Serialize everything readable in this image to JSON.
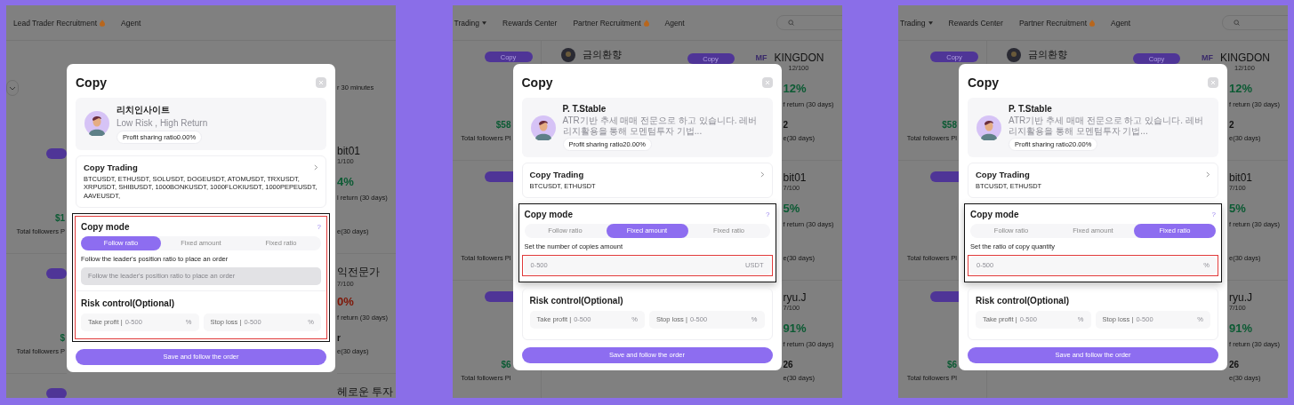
{
  "panels": [
    {
      "kind": "filtered",
      "nav": [
        {
          "label": "Lead Trader Recruitment",
          "dropdown": false,
          "hot": true
        },
        {
          "label": "Agent",
          "dropdown": false,
          "hot": false
        }
      ],
      "toolbar_text": "r 30 minutes",
      "left_cards": [
        {
          "kind": "copy-card",
          "value": "$1",
          "label": "Total followers P"
        },
        {
          "kind": "copy-card",
          "value": "$",
          "label": "Total followers P"
        },
        {
          "kind": "copy-card"
        }
      ],
      "right_cards": [
        {
          "name": "bit01",
          "count": "1/100",
          "pct": "4%",
          "color": "#0b5a33",
          "return_label": "l return (30 days)",
          "stat_label": "e(30 days)"
        },
        {
          "name": "익전문가",
          "count": "7/100",
          "pct": "0%",
          "color": "#7e1606",
          "return_label": "f return (30 days)",
          "stat": "r",
          "stat_label": "e(30 days)"
        },
        {
          "name": "헤로운 투자"
        }
      ],
      "dialog": {
        "title": "Copy",
        "trader": {
          "name": "리치인사이트",
          "description": "Low Risk , High Return",
          "badge": "Profit sharing ratio0.00%"
        },
        "copy_trading": {
          "title": "Copy Trading",
          "symbols": "BTCUSDT, ETHUSDT, SOLUSDT, DOGEUSDT, ATOMUSDT, TRXUSDT, XRPUSDT, SHIBUSDT, 1000BONKUSDT, 1000FLOKIUSDT, 1000PEPEUSDT, AAVEUSDT,"
        },
        "copy_mode": {
          "title": "Copy mode",
          "help": "?",
          "annotation": {
            "kind": "sections"
          },
          "tabs": [
            {
              "label": "Follow ratio",
              "selected": true
            },
            {
              "label": "Fixed amount",
              "selected": false
            },
            {
              "label": "Fixed ratio",
              "selected": false
            }
          ],
          "description": "Follow the leader's position ratio to place an order",
          "field": {
            "placeholder": "Follow the leader's position ratio to place an order",
            "disabled": true
          }
        },
        "risk": {
          "title": "Risk control(Optional)",
          "fields": [
            {
              "label": "Take profit |",
              "placeholder": "0-500",
              "suffix": "%"
            },
            {
              "label": "Stop loss |",
              "placeholder": "0-500",
              "suffix": "%"
            }
          ]
        },
        "save": "Save and follow the order"
      }
    },
    {
      "kind": "overview",
      "nav": [
        {
          "label": "Trading",
          "dropdown": true,
          "hot": false
        },
        {
          "label": "Rewards Center",
          "dropdown": false,
          "hot": false
        },
        {
          "label": "Partner Recruitment",
          "dropdown": false,
          "hot": true
        },
        {
          "label": "Agent",
          "dropdown": false,
          "hot": false
        }
      ],
      "search": true,
      "left_cards": [
        {
          "kind": "copy-card",
          "button": "Copy",
          "value": "$58",
          "label": "Total followers Pl"
        },
        {
          "kind": "copy-card",
          "label": "Total followers Pl"
        },
        {
          "kind": "copy-card",
          "value": "$6",
          "label": "Total followers Pl"
        }
      ],
      "middle_card": {
        "name": "금의환향",
        "button": "Copy"
      },
      "right_cards": [
        {
          "logo": "MF",
          "name": "KINGDON",
          "count": "12/100",
          "pct": "12%",
          "color": "#0b5a33",
          "return_label": "f return (30 days)",
          "stat": "2",
          "stat_label": "e(30 days)"
        },
        {
          "name": "bit01",
          "count": "7/100",
          "pct": "5%",
          "color": "#0b5a33",
          "return_label": "f return (30 days)",
          "stat_label": "e(30 days)"
        },
        {
          "name": "ryu.J",
          "count": "7/100",
          "pct": "91%",
          "color": "#0b5a33",
          "return_label": "f return (30 days)",
          "stat": "26",
          "stat_label": "e(30 days)"
        }
      ],
      "dialog": {
        "title": "Copy",
        "trader": {
          "name": "P. T.Stable",
          "description": "ATR기반 추세 매매 전문으로 하고 있습니다. 레버리지활용을 통해 모멘텀투자 기법...",
          "badge": "Profit sharing ratio20.00%"
        },
        "copy_trading": {
          "title": "Copy Trading",
          "symbols": "BTCUSDT, ETHUSDT"
        },
        "copy_mode": {
          "title": "Copy mode",
          "help": "?",
          "annotation": {
            "kind": "field"
          },
          "tabs": [
            {
              "label": "Follow ratio",
              "selected": false
            },
            {
              "label": "Fixed amount",
              "selected": true
            },
            {
              "label": "Fixed ratio",
              "selected": false
            }
          ],
          "description": "Set the number of copies amount",
          "field": {
            "placeholder": "0-500",
            "suffix": "USDT",
            "disabled": false
          }
        },
        "risk": {
          "title": "Risk control(Optional)",
          "fields": [
            {
              "label": "Take profit |",
              "placeholder": "0-500",
              "suffix": "%"
            },
            {
              "label": "Stop loss |",
              "placeholder": "0-500",
              "suffix": "%"
            }
          ]
        },
        "save": "Save and follow the order"
      }
    },
    {
      "kind": "overview",
      "nav": [
        {
          "label": "Trading",
          "dropdown": true,
          "hot": false
        },
        {
          "label": "Rewards Center",
          "dropdown": false,
          "hot": false
        },
        {
          "label": "Partner Recruitment",
          "dropdown": false,
          "hot": true
        },
        {
          "label": "Agent",
          "dropdown": false,
          "hot": false
        }
      ],
      "search": true,
      "left_cards": [
        {
          "kind": "copy-card",
          "button": "Copy",
          "value": "$58",
          "label": "Total followers Pl"
        },
        {
          "kind": "copy-card",
          "label": "Total followers Pl"
        },
        {
          "kind": "copy-card",
          "value": "$6",
          "label": "Total followers Pl"
        }
      ],
      "middle_card": {
        "name": "금의환향",
        "button": "Copy"
      },
      "right_cards": [
        {
          "logo": "MF",
          "name": "KINGDON",
          "count": "12/100",
          "pct": "12%",
          "color": "#0b5a33",
          "return_label": "f return (30 days)",
          "stat": "2",
          "stat_label": "e(30 days)"
        },
        {
          "name": "bit01",
          "count": "7/100",
          "pct": "5%",
          "color": "#0b5a33",
          "return_label": "f return (30 days)",
          "stat_label": "e(30 days)"
        },
        {
          "name": "ryu.J",
          "count": "7/100",
          "pct": "91%",
          "color": "#0b5a33",
          "return_label": "f return (30 days)",
          "stat": "26",
          "stat_label": "e(30 days)"
        }
      ],
      "dialog": {
        "title": "Copy",
        "trader": {
          "name": "P. T.Stable",
          "description": "ATR기반 추세 매매 전문으로 하고 있습니다. 레버리지활용을 통해 모멘텀투자 기법...",
          "badge": "Profit sharing ratio20.00%"
        },
        "copy_trading": {
          "title": "Copy Trading",
          "symbols": "BTCUSDT, ETHUSDT"
        },
        "copy_mode": {
          "title": "Copy mode",
          "help": "?",
          "annotation": {
            "kind": "field"
          },
          "tabs": [
            {
              "label": "Follow ratio",
              "selected": false
            },
            {
              "label": "Fixed amount",
              "selected": false
            },
            {
              "label": "Fixed ratio",
              "selected": true
            }
          ],
          "description": "Set the ratio of copy quantity",
          "field": {
            "placeholder": "0-500",
            "suffix": "%",
            "disabled": false
          }
        },
        "risk": {
          "title": "Risk control(Optional)",
          "fields": [
            {
              "label": "Take profit |",
              "placeholder": "0-500",
              "suffix": "%"
            },
            {
              "label": "Stop loss |",
              "placeholder": "0-500",
              "suffix": "%"
            }
          ]
        },
        "save": "Save and follow the order"
      }
    }
  ]
}
